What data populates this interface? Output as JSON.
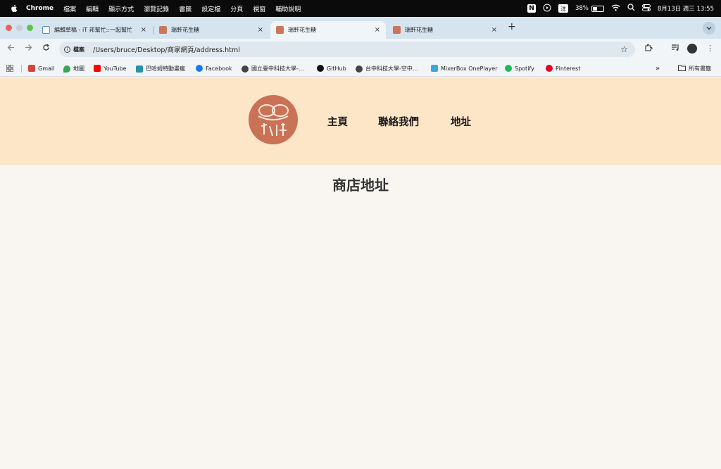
{
  "menubar": {
    "items": [
      "Chrome",
      "檔案",
      "編輯",
      "顯示方式",
      "瀏覽記錄",
      "書籤",
      "設定檔",
      "分頁",
      "視窗",
      "輔助說明"
    ],
    "ime": "注",
    "battery": "38%",
    "datetime": "8月13日 週三  13:55"
  },
  "tabs": [
    {
      "title": "編輯草稿 - iT 邦幫忙::一起幫忙",
      "close": "×"
    },
    {
      "title": "瑞軒花生糖",
      "close": "×"
    },
    {
      "title": "瑞軒花生糖",
      "close": "×"
    },
    {
      "title": "瑞軒花生糖",
      "close": "×"
    }
  ],
  "toolbar": {
    "scheme": "檔案",
    "url": "/Users/bruce/Desktop/商家網頁/address.html"
  },
  "bookmarks": [
    {
      "label": "Gmail",
      "color": "#d44638"
    },
    {
      "label": "地圖",
      "color": "#34a853"
    },
    {
      "label": "YouTube",
      "color": "#ff0000"
    },
    {
      "label": "巴哈姆特動畫瘋",
      "color": "#2a8fa8"
    },
    {
      "label": "Facebook",
      "color": "#1877f2"
    },
    {
      "label": "國立臺中科技大學-...",
      "color": "#444444"
    },
    {
      "label": "GitHub",
      "color": "#111111"
    },
    {
      "label": "台中科技大學-空中...",
      "color": "#444444"
    },
    {
      "label": "MixerBox OnePlayer",
      "color": "#3aa7e0"
    },
    {
      "label": "Spotify",
      "color": "#1db954"
    },
    {
      "label": "Pinterest",
      "color": "#e60023"
    }
  ],
  "bookmarks_all": "所有書籤",
  "site": {
    "logo_text": "瑞軒\n花生糖",
    "nav": [
      "主頁",
      "聯絡我們",
      "地址"
    ],
    "page_title": "商店地址"
  },
  "colors": {
    "header_bg": "#fde5c7",
    "page_bg": "#f9f6f1",
    "logo_bg": "#c97256"
  }
}
